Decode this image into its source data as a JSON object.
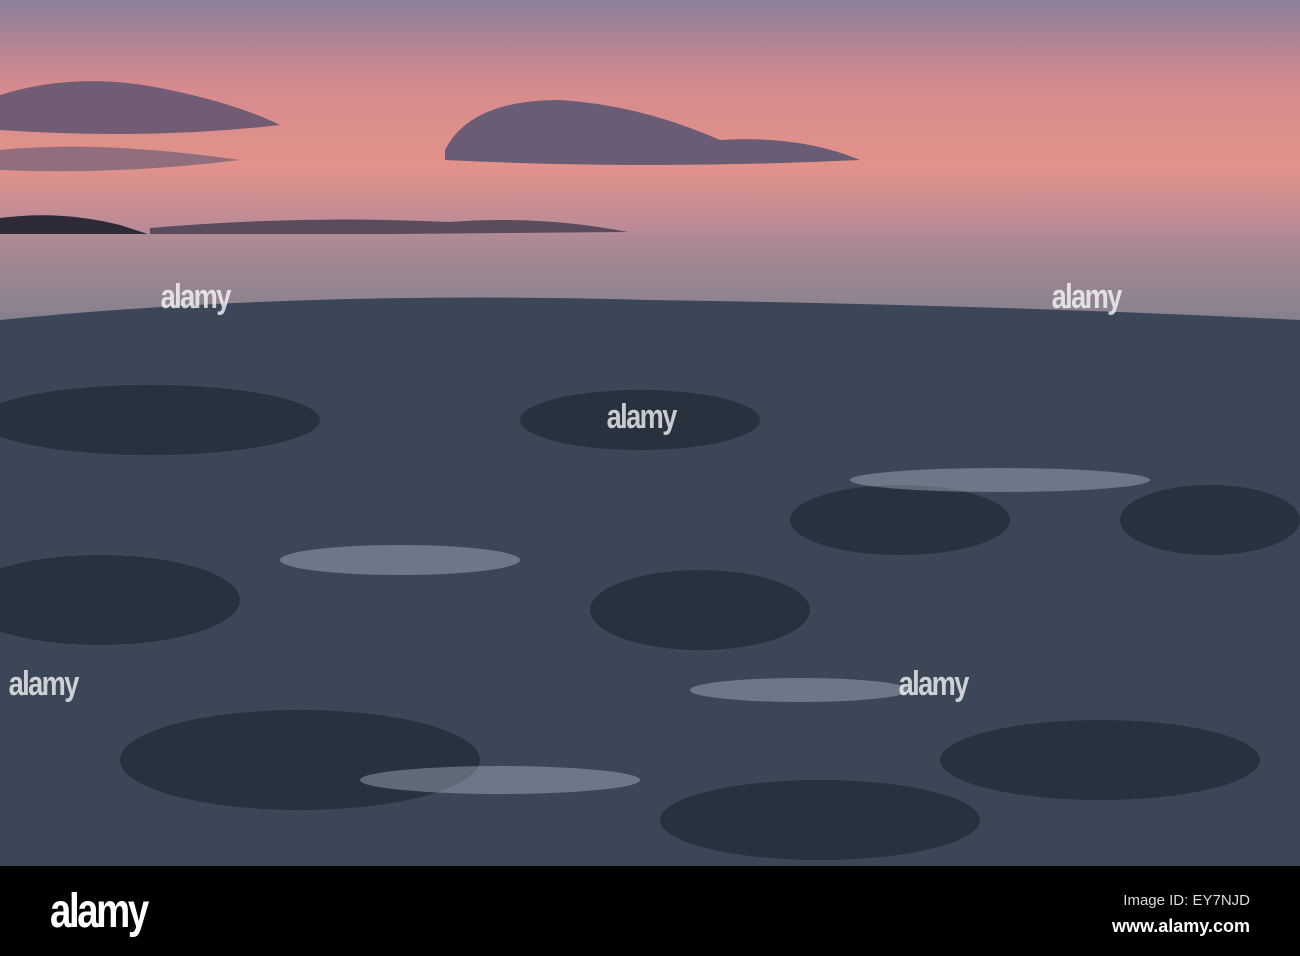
{
  "watermark": {
    "text": "alamy"
  },
  "footer": {
    "logo": "alamy",
    "image_id": "Image ID: EY7NJD",
    "website": "www.alamy.com"
  },
  "colors": {
    "sky_top": "#7a7390",
    "sky_glow": "#e88a80",
    "sea": "#5a6478",
    "rocks": "#2a3340"
  }
}
